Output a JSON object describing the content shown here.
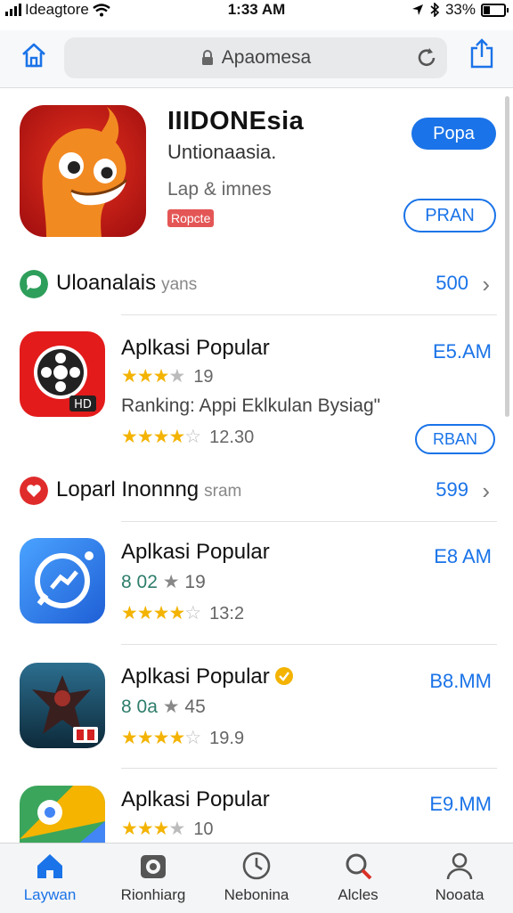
{
  "status_bar": {
    "carrier": "Ideagtore",
    "time": "1:33 AM",
    "battery": "33%"
  },
  "browser": {
    "url": "Apaomesa"
  },
  "featured": {
    "title": "IIIDONEsia",
    "subtitle": "Untionaasia.",
    "tagline": "Lap & imnes",
    "badge": "Ropcte",
    "primary_button": "Popa",
    "secondary_button": "PRAN"
  },
  "sections": [
    {
      "title": "Uloanalais",
      "suffix": "yans",
      "count": "500",
      "icon_color": "#2e9e5b"
    },
    {
      "title": "Loparl Inonnng",
      "suffix": "sram",
      "count": "599",
      "icon_color": "#e02b2b"
    }
  ],
  "apps": [
    {
      "name": "Aplkasi Popular",
      "size": "E5.AM",
      "meta1": "19",
      "ranking": "Ranking: Appi Eklkulan Bysiag\"",
      "rating_text": "12.30",
      "button": "RBAN",
      "stars": 4
    },
    {
      "name": "Aplkasi Popular",
      "size": "E8 AM",
      "meta_prefix": "8 02",
      "meta1": "19",
      "rating_text": "13:2",
      "stars": 4
    },
    {
      "name": "Aplkasi Popular",
      "size": "B8.MM",
      "meta_prefix": "8 0a",
      "meta1": "45",
      "rating_text": "19.9",
      "stars": 4
    },
    {
      "name": "Aplkasi Popular",
      "size": "E9.MM",
      "meta1": "10",
      "stars": 4
    }
  ],
  "tabs": [
    {
      "label": "Laywan",
      "icon": "home-icon",
      "active": true
    },
    {
      "label": "Rionhiarg",
      "icon": "camera-icon",
      "active": false
    },
    {
      "label": "Nebonina",
      "icon": "clock-icon",
      "active": false
    },
    {
      "label": "Alcles",
      "icon": "search-icon",
      "active": false
    },
    {
      "label": "Nooata",
      "icon": "person-icon",
      "active": false
    }
  ],
  "colors": {
    "accent": "#1a73e8",
    "star": "#f3b300",
    "badge": "#e45656"
  }
}
